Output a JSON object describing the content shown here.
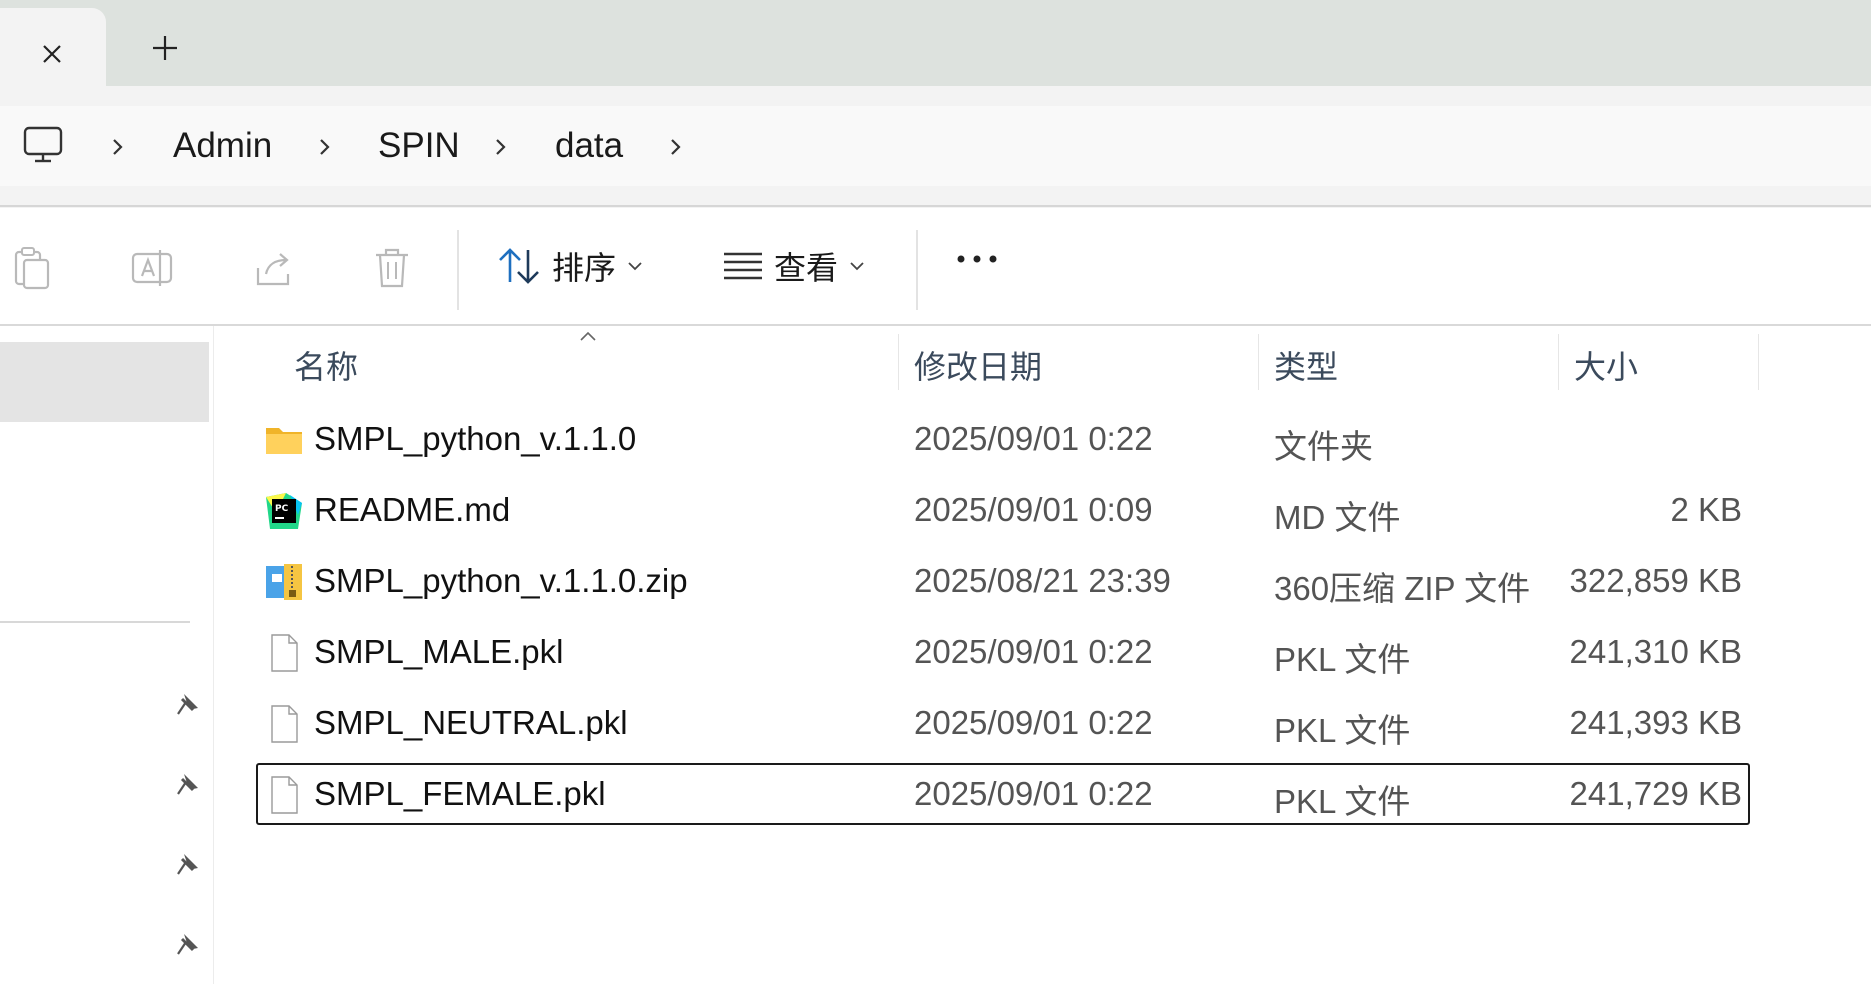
{
  "tabs": {
    "close_icon": "close-icon",
    "new_tab_icon": "plus-icon"
  },
  "address": {
    "root_icon": "this-pc-icon",
    "crumbs": [
      "Admin",
      "SPIN",
      "data"
    ]
  },
  "commandbar": {
    "sort_label": "排序",
    "view_label": "查看",
    "more_icon": "more-icon"
  },
  "columns": {
    "name": "名称",
    "modified": "修改日期",
    "type": "类型",
    "size": "大小"
  },
  "files": [
    {
      "name": "SMPL_python_v.1.1.0",
      "modified": "2025/09/01 0:22",
      "type": "文件夹",
      "size": "",
      "icon": "folder-icon"
    },
    {
      "name": "README.md",
      "modified": "2025/09/01 0:09",
      "type": "MD 文件",
      "size": "2 KB",
      "icon": "pycharm-icon"
    },
    {
      "name": "SMPL_python_v.1.1.0.zip",
      "modified": "2025/08/21 23:39",
      "type": "360压缩 ZIP 文件",
      "size": "322,859 KB",
      "icon": "zip-archive-icon"
    },
    {
      "name": "SMPL_MALE.pkl",
      "modified": "2025/09/01 0:22",
      "type": "PKL 文件",
      "size": "241,310 KB",
      "icon": "file-icon"
    },
    {
      "name": "SMPL_NEUTRAL.pkl",
      "modified": "2025/09/01 0:22",
      "type": "PKL 文件",
      "size": "241,393 KB",
      "icon": "file-icon"
    },
    {
      "name": "SMPL_FEMALE.pkl",
      "modified": "2025/09/01 0:22",
      "type": "PKL 文件",
      "size": "241,729 KB",
      "icon": "file-icon"
    }
  ],
  "colors": {
    "tabstrip_bg": "#dde2de",
    "focus_border": "#1a1a1a",
    "accent": "#1e6fbf"
  }
}
